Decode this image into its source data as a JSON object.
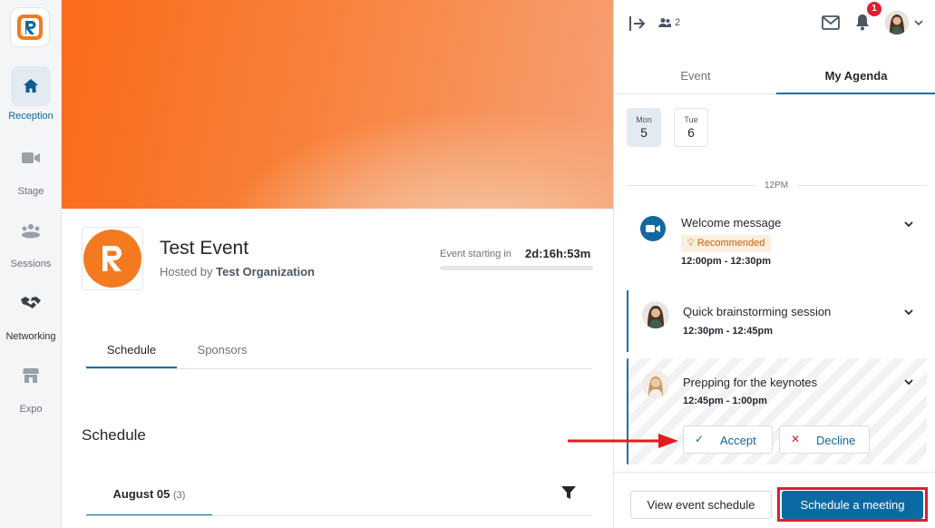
{
  "nav": {
    "items": [
      {
        "label": "Reception",
        "icon": "home-icon",
        "active": true
      },
      {
        "label": "Stage",
        "icon": "video-camera-icon"
      },
      {
        "label": "Sessions",
        "icon": "people-group-icon"
      },
      {
        "label": "Networking",
        "icon": "handshake-icon"
      },
      {
        "label": "Expo",
        "icon": "storefront-icon"
      }
    ]
  },
  "event": {
    "title": "Test Event",
    "hosted_prefix": "Hosted by",
    "organization": "Test Organization",
    "starting_label": "Event starting in",
    "countdown": "2d:16h:53m",
    "tabs": [
      "Schedule",
      "Sponsors"
    ],
    "schedule_heading": "Schedule",
    "date_tab": "August 05",
    "date_count": "(3)"
  },
  "panel": {
    "attendee_count": "2",
    "notification_count": "1",
    "tabs": [
      "Event",
      "My Agenda"
    ],
    "days": [
      {
        "name": "Mon",
        "num": "5",
        "active": true
      },
      {
        "name": "Tue",
        "num": "6"
      }
    ],
    "time_marker": "12PM",
    "items": [
      {
        "title": "Welcome message",
        "tag": "Recommended",
        "time": "12:00pm - 12:30pm"
      },
      {
        "title": "Quick brainstorming session",
        "time": "12:30pm - 12:45pm"
      },
      {
        "title": "Prepping for the keynotes",
        "time": "12:45pm - 1:00pm"
      }
    ],
    "accept_label": "Accept",
    "decline_label": "Decline",
    "view_schedule_label": "View event schedule",
    "schedule_meeting_label": "Schedule a meeting"
  },
  "colors": {
    "accent": "#0b6aa2",
    "brand_orange": "#f47a20",
    "alert_red": "#e11d2e"
  }
}
